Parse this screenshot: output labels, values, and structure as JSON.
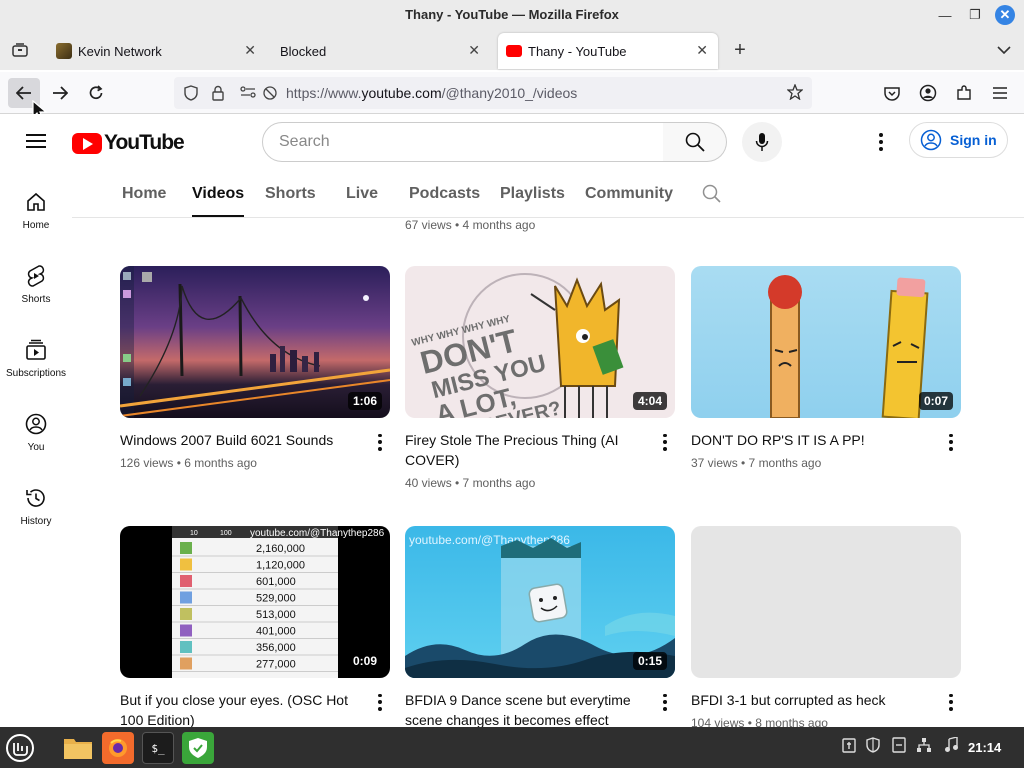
{
  "window": {
    "title": "Thany - YouTube — Mozilla Firefox",
    "minimize_icon": "minimize-icon",
    "maximize_icon": "maximize-icon",
    "close_icon": "close-icon"
  },
  "tabs": [
    {
      "label": "Kevin Network",
      "icon": "kevin-network-favicon"
    },
    {
      "label": "Blocked",
      "icon": ""
    },
    {
      "label": "Thany - YouTube",
      "icon": "youtube-favicon",
      "active": true
    }
  ],
  "urlbar": {
    "prefix": "https://www.",
    "domain": "youtube.com",
    "path": "/@thany2010_/videos"
  },
  "youtube": {
    "logo_text": "YouTube",
    "search_placeholder": "Search",
    "sign_in": "Sign in",
    "guide": [
      {
        "label": "Home",
        "icon": "home-icon"
      },
      {
        "label": "Shorts",
        "icon": "shorts-icon"
      },
      {
        "label": "Subscriptions",
        "icon": "subscriptions-icon"
      },
      {
        "label": "You",
        "icon": "you-icon"
      },
      {
        "label": "History",
        "icon": "history-icon"
      }
    ],
    "channel_tabs": [
      "Home",
      "Videos",
      "Shorts",
      "Live",
      "Podcasts",
      "Playlists",
      "Community"
    ],
    "active_channel_tab": "Videos",
    "previous_row_meta": "67 views • 4 months ago",
    "videos": [
      {
        "title": "Windows 2007 Build 6021 Sounds",
        "meta": "126 views • 6 months ago",
        "duration": "1:06",
        "thumb": "night-bridge-desktop"
      },
      {
        "title": "Firey Stole The Precious Thing (AI COVER)",
        "meta": "40 views • 7 months ago",
        "duration": "4:04",
        "thumb": "dont-miss-you-firey"
      },
      {
        "title": "DON'T DO RP'S IT IS A PP!",
        "meta": "37 views • 7 months ago",
        "duration": "0:07",
        "thumb": "match-and-pencil"
      },
      {
        "title": "But if you close your eyes. (OSC Hot 100 Edition)",
        "meta": "",
        "duration": "0:09",
        "thumb": "leaderboard"
      },
      {
        "title": "BFDIA 9 Dance scene but everytime scene changes it becomes effect",
        "meta": "",
        "duration": "0:15",
        "thumb": "bfdia-dance"
      },
      {
        "title": "BFDI 3-1 but corrupted as heck",
        "meta": "104 views • 8 months ago",
        "duration": "",
        "thumb": "placeholder-grey"
      }
    ],
    "thumb_overlays": {
      "watermark_1": "youtube.com/@Thanythep286",
      "watermark_2": "youtube.com/@Thanythep286",
      "dont_miss_text_1": "WHY WHY WHY WHY",
      "dont_miss_text_2": "DON'T",
      "dont_miss_text_3": "MISS YOU",
      "dont_miss_text_4": "A LOT,",
      "dont_miss_text_5": "FOREVER?",
      "leaderboard_header_1": "10",
      "leaderboard_header_2": "100",
      "leaderboard_values": [
        "2,160,000",
        "1,120,000",
        "601,000",
        "529,000",
        "513,000",
        "401,000",
        "356,000",
        "277,000"
      ]
    }
  },
  "taskbar": {
    "clock": "21:14",
    "apps": [
      "mint-menu-icon",
      "files-icon",
      "firefox-icon",
      "terminal-icon",
      "shield-app-icon"
    ]
  },
  "colors": {
    "youtube_red": "#ff0000",
    "link_blue": "#065fd4",
    "firefox_close": "#3584e4"
  }
}
